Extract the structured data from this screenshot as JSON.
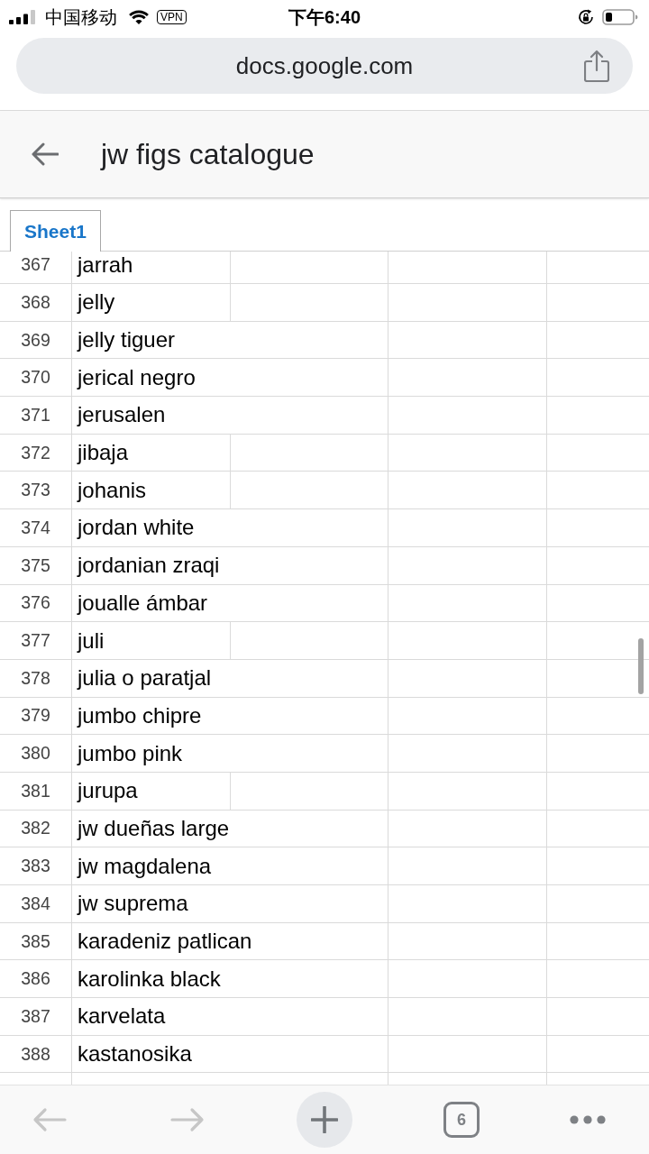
{
  "status_bar": {
    "carrier": "中国移动",
    "vpn": "VPN",
    "time": "下午6:40"
  },
  "address_bar": {
    "url": "docs.google.com"
  },
  "header": {
    "title": "jw figs catalogue"
  },
  "sheet_tabs": [
    {
      "label": "Sheet1",
      "selected": true
    }
  ],
  "grid": {
    "rows": [
      {
        "number": "367",
        "name": "jarrah",
        "spans_next_column": false
      },
      {
        "number": "368",
        "name": "jelly",
        "spans_next_column": false
      },
      {
        "number": "369",
        "name": "jelly tiguer",
        "spans_next_column": true
      },
      {
        "number": "370",
        "name": "jerical negro",
        "spans_next_column": true
      },
      {
        "number": "371",
        "name": "jerusalen",
        "spans_next_column": true
      },
      {
        "number": "372",
        "name": "jibaja",
        "spans_next_column": false
      },
      {
        "number": "373",
        "name": "johanis",
        "spans_next_column": false
      },
      {
        "number": "374",
        "name": "jordan white",
        "spans_next_column": true
      },
      {
        "number": "375",
        "name": "jordanian zraqi",
        "spans_next_column": true
      },
      {
        "number": "376",
        "name": "joualle ámbar",
        "spans_next_column": true
      },
      {
        "number": "377",
        "name": "juli",
        "spans_next_column": false
      },
      {
        "number": "378",
        "name": "julia o paratjal",
        "spans_next_column": true
      },
      {
        "number": "379",
        "name": "jumbo chipre",
        "spans_next_column": true
      },
      {
        "number": "380",
        "name": "jumbo pink",
        "spans_next_column": true
      },
      {
        "number": "381",
        "name": "jurupa",
        "spans_next_column": false
      },
      {
        "number": "382",
        "name": "jw dueñas large",
        "spans_next_column": true
      },
      {
        "number": "383",
        "name": "jw magdalena",
        "spans_next_column": true
      },
      {
        "number": "384",
        "name": "jw suprema",
        "spans_next_column": true
      },
      {
        "number": "385",
        "name": "karadeniz patlican",
        "spans_next_column": true
      },
      {
        "number": "386",
        "name": "karolinka black",
        "spans_next_column": true
      },
      {
        "number": "387",
        "name": "karvelata",
        "spans_next_column": true
      },
      {
        "number": "388",
        "name": "kastanosika",
        "spans_next_column": true
      }
    ]
  },
  "toolbar": {
    "back": {
      "disabled": true
    },
    "forward": {
      "disabled": true
    },
    "tab_count": "6"
  }
}
